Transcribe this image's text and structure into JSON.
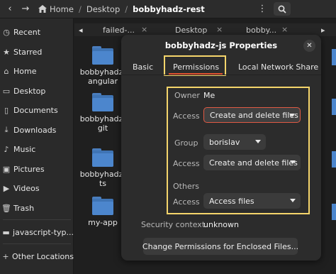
{
  "header": {
    "crumbs": [
      "Home",
      "Desktop",
      "bobbyhadz-rest"
    ]
  },
  "sidebar": {
    "items": [
      {
        "label": "Recent",
        "icon": "clock-icon"
      },
      {
        "label": "Starred",
        "icon": "star-icon"
      },
      {
        "label": "Home",
        "icon": "home-icon"
      },
      {
        "label": "Desktop",
        "icon": "desktop-icon"
      },
      {
        "label": "Documents",
        "icon": "document-icon"
      },
      {
        "label": "Downloads",
        "icon": "download-icon"
      },
      {
        "label": "Music",
        "icon": "music-icon"
      },
      {
        "label": "Pictures",
        "icon": "picture-icon"
      },
      {
        "label": "Videos",
        "icon": "video-icon"
      },
      {
        "label": "Trash",
        "icon": "trash-icon"
      },
      {
        "label": "javascript-typ...",
        "icon": "folder-icon"
      },
      {
        "label": "Other Locations",
        "icon": "plus-icon"
      }
    ]
  },
  "tabs": [
    {
      "label": "failed-..."
    },
    {
      "label": "Desktop"
    },
    {
      "label": "bobby..."
    }
  ],
  "files": [
    {
      "name": "bobbyhadz-\nangular"
    },
    {
      "name": "bobbyhadz-\ngit"
    },
    {
      "name": "bobbyhadz-\nts"
    },
    {
      "name": "my-app"
    }
  ],
  "dialog": {
    "title": "bobbyhadz-js Properties",
    "tabs": [
      "Basic",
      "Permissions",
      "Local Network Share"
    ],
    "owner_label": "Owner",
    "owner_value": "Me",
    "owner_access_label": "Access",
    "owner_access_value": "Create and delete files",
    "group_label": "Group",
    "group_value": "borislav",
    "group_access_label": "Access",
    "group_access_value": "Create and delete files",
    "others_label": "Others",
    "others_access_label": "Access",
    "others_access_value": "Access files",
    "security_label": "Security context",
    "security_value": "unknown",
    "change_button": "Change Permissions for Enclosed Files..."
  },
  "colors": {
    "highlight": "#f5d56b",
    "accent": "#e0512f",
    "folder": "#4c86cd"
  }
}
